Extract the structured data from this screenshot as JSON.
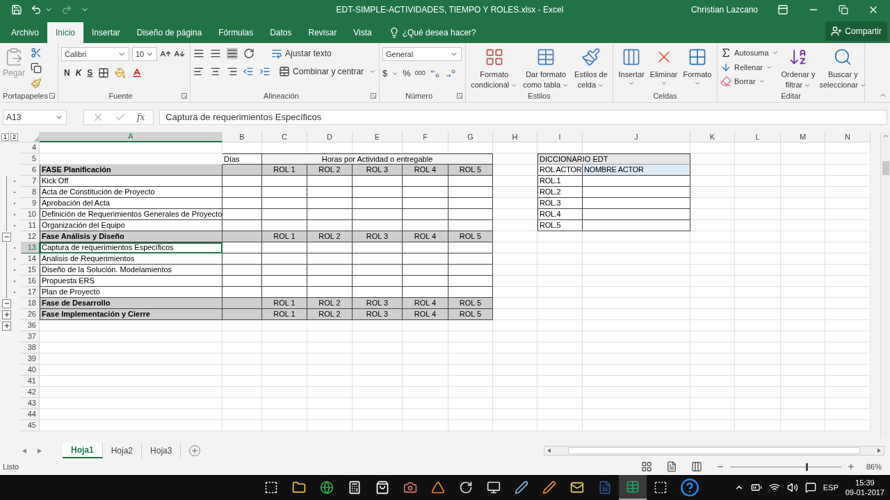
{
  "window": {
    "title": "EDT-SIMPLE-ACTIVIDADES, TIEMPO Y ROLES.xlsx - Excel",
    "user": "Christian Lazcano"
  },
  "tabs": [
    {
      "label": "Archivo",
      "selected": false
    },
    {
      "label": "Inicio",
      "selected": true
    },
    {
      "label": "Insertar",
      "selected": false
    },
    {
      "label": "Diseño de página",
      "selected": false
    },
    {
      "label": "Fórmulas",
      "selected": false
    },
    {
      "label": "Datos",
      "selected": false
    },
    {
      "label": "Revisar",
      "selected": false
    },
    {
      "label": "Vista",
      "selected": false
    }
  ],
  "tell_me": "¿Qué desea hacer?",
  "share": "Compartir",
  "ribbon": {
    "clipboard": {
      "paste": "Pegar",
      "paste_disabled": true,
      "group": "Portapapeles"
    },
    "font": {
      "name": "Calibri",
      "size": "10",
      "bold": "N",
      "italic": "K",
      "underline": "S",
      "group": "Fuente"
    },
    "alignment": {
      "wrap": "Ajustar texto",
      "merge": "Combinar y centrar",
      "group": "Alineación"
    },
    "number": {
      "format": "General",
      "currency": "$",
      "percent": "%",
      "thousands": "000",
      "group": "Número"
    },
    "styles": {
      "group": "Estilos",
      "buttons": [
        {
          "kind": "conditional",
          "lines": [
            "Formato",
            "condicional"
          ]
        },
        {
          "kind": "table",
          "lines": [
            "Dar formato",
            "como tabla"
          ]
        },
        {
          "kind": "cellstyle",
          "lines": [
            "Estilos de",
            "celda"
          ]
        }
      ]
    },
    "cells": {
      "group": "Celdas",
      "buttons": [
        {
          "kind": "insert",
          "lines": [
            "Insertar"
          ]
        },
        {
          "kind": "delete",
          "lines": [
            "Eliminar"
          ]
        },
        {
          "kind": "format",
          "lines": [
            "Formato"
          ]
        }
      ]
    },
    "editing": {
      "group": "Editar",
      "small": [
        {
          "kind": "sum",
          "label": "Autosuma"
        },
        {
          "kind": "fill",
          "label": "Rellenar"
        },
        {
          "kind": "clear",
          "label": "Borrar"
        }
      ],
      "buttons": [
        {
          "kind": "sort",
          "lines": [
            "Ordenar y",
            "filtrar"
          ]
        },
        {
          "kind": "find",
          "lines": [
            "Buscar y",
            "seleccionar"
          ]
        }
      ]
    }
  },
  "formula_bar": {
    "name_box": "A13",
    "fx": "fx",
    "value": "Captura de requerimientos Específicos"
  },
  "outline_levels": [
    "1",
    "2"
  ],
  "columns": [
    {
      "label": "A",
      "selected": true
    },
    {
      "label": "B",
      "selected": false
    },
    {
      "label": "C",
      "selected": false
    },
    {
      "label": "D",
      "selected": false
    },
    {
      "label": "E",
      "selected": false
    },
    {
      "label": "F",
      "selected": false
    },
    {
      "label": "G",
      "selected": false
    },
    {
      "label": "H",
      "selected": false
    },
    {
      "label": "I",
      "selected": false
    },
    {
      "label": "J",
      "selected": false
    },
    {
      "label": "K",
      "selected": false
    },
    {
      "label": "L",
      "selected": false
    },
    {
      "label": "M",
      "selected": false
    },
    {
      "label": "N",
      "selected": false
    }
  ],
  "rows": [
    {
      "number": "4",
      "kind": "blank",
      "selected": false
    },
    {
      "number": "5",
      "kind": "header",
      "selected": false,
      "days": "Días",
      "span": "Horas por Actividad o entregable"
    },
    {
      "number": "6",
      "kind": "phase",
      "selected": false,
      "label": "FASE Planificación",
      "roles": [
        "ROL 1",
        "ROL 2",
        "ROL 3",
        "ROL 4",
        "ROL 5"
      ]
    },
    {
      "number": "7",
      "kind": "task",
      "selected": false,
      "outline": {
        "kind": "dot"
      },
      "label": "Kick Off"
    },
    {
      "number": "8",
      "kind": "task",
      "selected": false,
      "outline": {
        "kind": "dot"
      },
      "label": "Acta de Constitución de Proyecto"
    },
    {
      "number": "9",
      "kind": "task",
      "selected": false,
      "outline": {
        "kind": "dot"
      },
      "label": "Aprobación del Acta"
    },
    {
      "number": "10",
      "kind": "task",
      "selected": false,
      "outline": {
        "kind": "dot"
      },
      "label": "Definición de Requerimientos Generales de Proyecto"
    },
    {
      "number": "11",
      "kind": "task",
      "selected": false,
      "outline": {
        "kind": "dot"
      },
      "label": "Organización del Equipo"
    },
    {
      "number": "12",
      "kind": "phase",
      "selected": false,
      "outline": {
        "kind": "minus"
      },
      "label": "Fase Análisis y Diseño",
      "roles": [
        "ROL 1",
        "ROL 2",
        "ROL 3",
        "ROL 4",
        "ROL 5"
      ]
    },
    {
      "number": "13",
      "kind": "task",
      "selected": true,
      "outline": {
        "kind": "dot"
      },
      "label": "Captura de requerimientos Específicos"
    },
    {
      "number": "14",
      "kind": "task",
      "selected": false,
      "outline": {
        "kind": "dot"
      },
      "label": "Analisis de Requerimientos"
    },
    {
      "number": "15",
      "kind": "task",
      "selected": false,
      "outline": {
        "kind": "dot"
      },
      "label": "Diseño de la Solución. Modelamientos"
    },
    {
      "number": "16",
      "kind": "task",
      "selected": false,
      "outline": {
        "kind": "dot"
      },
      "label": "Propuesta ERS"
    },
    {
      "number": "17",
      "kind": "task",
      "selected": false,
      "outline": {
        "kind": "dot"
      },
      "label": "Plan de Proyecto"
    },
    {
      "number": "18",
      "kind": "phase",
      "selected": false,
      "outline": {
        "kind": "minus"
      },
      "label": "Fase de Desarrollo",
      "roles": [
        "ROL 1",
        "ROL 2",
        "ROL 3",
        "ROL 4",
        "ROL 5"
      ]
    },
    {
      "number": "26",
      "kind": "phase",
      "selected": false,
      "outline": {
        "kind": "plus"
      },
      "label": "Fase Implementación y Cierre",
      "roles": [
        "ROL 1",
        "ROL 2",
        "ROL 3",
        "ROL 4",
        "ROL 5"
      ]
    },
    {
      "number": "36",
      "kind": "blank",
      "selected": false,
      "outline": {
        "kind": "plus"
      }
    },
    {
      "number": "37",
      "kind": "blank",
      "selected": false
    },
    {
      "number": "38",
      "kind": "blank",
      "selected": false
    },
    {
      "number": "39",
      "kind": "blank",
      "selected": false
    },
    {
      "number": "40",
      "kind": "blank",
      "selected": false
    },
    {
      "number": "41",
      "kind": "blank",
      "selected": false
    },
    {
      "number": "42",
      "kind": "blank",
      "selected": false
    },
    {
      "number": "43",
      "kind": "blank",
      "selected": false
    },
    {
      "number": "44",
      "kind": "blank",
      "selected": false
    },
    {
      "number": "45",
      "kind": "blank",
      "selected": false
    }
  ],
  "dictionary": {
    "title": "DICCIONARIO EDT",
    "headers": [
      "ROL ACTOR",
      "NOMBRE ACTOR"
    ],
    "roles": [
      "ROL.1",
      "ROL.2",
      "ROL.3",
      "ROL.4",
      "ROL.5"
    ]
  },
  "sheets": [
    {
      "label": "Hoja1",
      "selected": true
    },
    {
      "label": "Hoja2",
      "selected": false
    },
    {
      "label": "Hoja3",
      "selected": false
    }
  ],
  "status_bar": {
    "status": "Listo",
    "zoom": "86%",
    "zoom_slider": {
      "level": 0.68
    }
  },
  "taskbar": {
    "language": "ESP",
    "time": "15:39",
    "date": "09-01-2017"
  }
}
